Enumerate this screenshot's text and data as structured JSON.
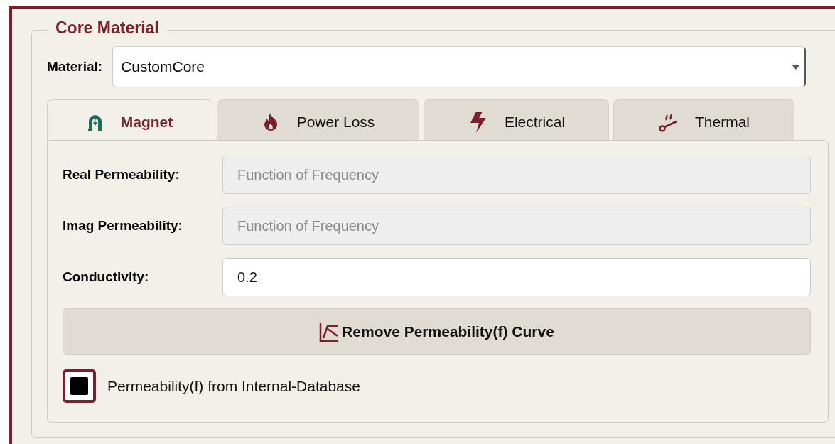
{
  "group": {
    "title": "Core Material"
  },
  "material": {
    "label": "Material:",
    "value": "CustomCore"
  },
  "tabs": [
    {
      "label": "Magnet",
      "kind": "magnet",
      "selected": true
    },
    {
      "label": "Power Loss",
      "kind": "flame",
      "selected": false
    },
    {
      "label": "Electrical",
      "kind": "bolt",
      "selected": false
    },
    {
      "label": "Thermal",
      "kind": "thermal",
      "selected": false
    }
  ],
  "fields": [
    {
      "label": "Real Permeability:",
      "value": "Function of Frequency",
      "disabled": true
    },
    {
      "label": "Imag Permeability:",
      "value": "Function of Frequency",
      "disabled": true
    },
    {
      "label": "Conductivity:",
      "value": "0.2",
      "disabled": false
    }
  ],
  "button": {
    "label": "Remove Permeability(f) Curve"
  },
  "checkbox": {
    "label": "Permeability(f) from Internal-Database",
    "checked": true
  }
}
